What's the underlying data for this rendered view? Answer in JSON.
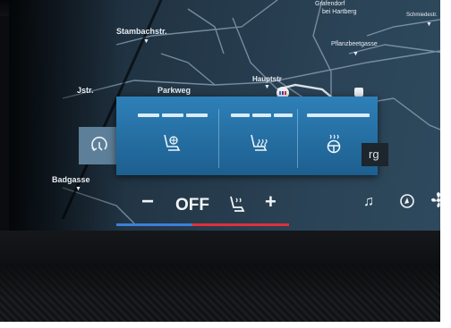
{
  "map": {
    "streets": {
      "stambachstr": "Stambachstr.",
      "jstr": "Jstr.",
      "parkweg": "Parkweg",
      "hauptstr": "Hauptstr",
      "pflanzbeetgasse": "Pflanzbeetgasse",
      "badgasse": "Badgasse",
      "schmiedestr": "Schmiedestr.",
      "grafendorf": "Grafendorf",
      "bei_hartberg": "bei Hartberg"
    }
  },
  "climate_popup": {
    "recirculation_icon": "air-recirculation-icon",
    "seat_ventilation": {
      "icon": "seat-ventilation-icon",
      "level": 0
    },
    "seat_heating": {
      "icon": "seat-heating-icon",
      "level": 0
    },
    "steering_wheel_heating": {
      "icon": "steering-wheel-heating-icon",
      "level": 0
    },
    "partial_text": "rg"
  },
  "climate_bar": {
    "minus_label": "−",
    "temperature_value": "OFF",
    "plus_label": "+",
    "seat_icon": "seat-climate-icon",
    "accent_blue": "#3d7fd8",
    "accent_red": "#e0303a"
  },
  "right_icons": {
    "media": "music-note-icon",
    "navigation": "navigation-compass-icon",
    "fan": "fan-icon"
  },
  "colors": {
    "popup_background": "#2a78ad",
    "recirc_tile": "#5d7f99"
  }
}
